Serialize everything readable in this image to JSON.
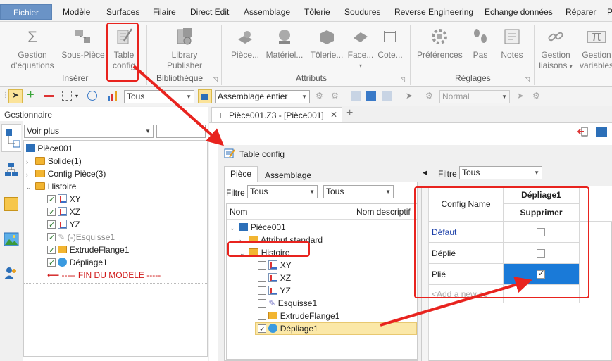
{
  "menu": {
    "file": "Fichier",
    "tabs": [
      "Modèle",
      "Surfaces",
      "Filaire",
      "Direct Edit",
      "Assemblage",
      "Tôlerie",
      "Soudures",
      "Reverse Engineering",
      "Echange données",
      "Réparer",
      "P"
    ]
  },
  "ribbon": {
    "inserer": {
      "label": "Insérer",
      "gestion_line1": "Gestion",
      "gestion_line2": "d'équations",
      "souspiece": "Sous-Pièce",
      "table_line1": "Table",
      "table_line2": "config"
    },
    "bibliotheque": {
      "label": "Bibliothèque",
      "library_line1": "Library",
      "library_line2": "Publisher"
    },
    "attributs": {
      "label": "Attributs",
      "piece": "Pièce...",
      "materiel": "Matériel...",
      "tolerie": "Tôlerie...",
      "face": "Face...",
      "cote": "Cote..."
    },
    "reglages": {
      "label": "Réglages",
      "preferences": "Préférences",
      "pas": "Pas",
      "notes": "Notes"
    },
    "liaisons": {
      "gestion_liaisons_1": "Gestion",
      "gestion_liaisons_2": "liaisons",
      "gestion_variables_1": "Gestion",
      "gestion_variables_2": "variables"
    }
  },
  "toolbar": {
    "filter_value": "Tous",
    "scope_value": "Assemblage entier",
    "view_value": "Normal"
  },
  "manager": {
    "title": "Gestionnaire",
    "voir_plus": "Voir plus",
    "tree": {
      "root": "Pièce001",
      "solide": "Solide(1)",
      "config": "Config Pièce(3)",
      "histoire": "Histoire",
      "xy": "XY",
      "xz": "XZ",
      "yz": "YZ",
      "esquisse": "(-)Esquisse1",
      "extrude": "ExtrudeFlange1",
      "depliage": "Dépliage1",
      "fin": "----- FIN DU MODELE -----"
    }
  },
  "document": {
    "tab_label": "Pièce001.Z3 - [Pièce001]"
  },
  "dialog": {
    "title": "Table config",
    "tabs": [
      "Pièce",
      "Assemblage"
    ],
    "filtre_label": "Filtre",
    "filtre_value1": "Tous",
    "filtre_value2": "Tous",
    "right_filtre_label": "Filtre",
    "right_filtre_value": "Tous",
    "col_nom": "Nom",
    "col_desc": "Nom descriptif",
    "tree": {
      "root": "Pièce001",
      "attribut": "Attribut standard",
      "histoire": "Histoire",
      "xy": "XY",
      "xz": "XZ",
      "yz": "YZ",
      "esquisse": "Esquisse1",
      "extrude": "ExtrudeFlange1",
      "depliage": "Dépliage1"
    },
    "grid": {
      "config_name_header": "Config Name",
      "col_header": "Dépliage1",
      "col_subheader": "Supprimer",
      "rows": [
        {
          "name": "Défaut",
          "checked": false
        },
        {
          "name": "Déplié",
          "checked": false
        },
        {
          "name": "Plié",
          "checked": true
        }
      ],
      "add_placeholder": "<Add a new co"
    }
  }
}
